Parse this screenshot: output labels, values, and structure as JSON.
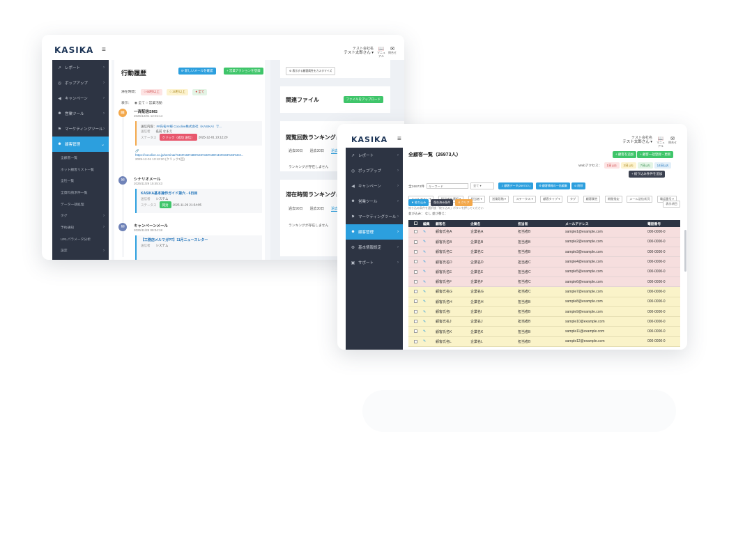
{
  "window1": {
    "logo": "KASIKA",
    "hamburger": "≡",
    "user": {
      "company": "テスト会社名",
      "name": "テスト太郎さん ▾"
    },
    "top_icons": [
      {
        "glyph": "📖",
        "label": "マニュアル"
      },
      {
        "glyph": "✉",
        "label": "問合せ"
      }
    ],
    "sidebar": [
      {
        "icon": "chart-icon",
        "glyph": "↗",
        "label": "レポート"
      },
      {
        "icon": "target-icon",
        "glyph": "◎",
        "label": "ポップアップ"
      },
      {
        "icon": "megaphone-icon",
        "glyph": "◀",
        "label": "キャンペーン"
      },
      {
        "icon": "user-plus-icon",
        "glyph": "☻",
        "label": "営業ツール"
      },
      {
        "icon": "flag-icon",
        "glyph": "⚑",
        "label": "マーケティングツール"
      },
      {
        "icon": "users-icon",
        "glyph": "☻",
        "label": "顧客管理"
      }
    ],
    "sidebar_sub": [
      "全顧客一覧",
      "ホット顧客リスト一覧",
      "全社一覧",
      "全資料請求件一覧",
      "データ一括処理",
      "タグ",
      "予約通知",
      "URLパラメータ分析",
      "設定"
    ],
    "main": {
      "title": "行動履歴",
      "btn_check": "⟳ 新しいメールを確認",
      "btn_add": "+ 営業アクションを登録",
      "filter_label": "滞在時間：",
      "filter_chips": [
        "○ 60秒以上",
        "○ 30秒以上",
        "● 全て"
      ],
      "display_label": "表示：",
      "display_opts": "◉ 全て ○ 営業活動",
      "timeline": [
        {
          "title": "一斉配信SMS",
          "date": "2025/12/01 12:01:14",
          "card_line1_prefix": "送信内容：",
          "card_line1": "##氏名##様 Cocolive株式会社（KASIKA）で...",
          "card_line2_label": "送信者",
          "card_line2": "名前 なまえ",
          "card_line3_label": "ステータス",
          "card_badge": "クリック（成功 送信）",
          "card_line3": "2025-12-01 13:12:20"
        },
        {
          "link": "https://cocolive.co.jp/seminar/%E3%82%B9%E3%83%86%E3%83%83%E3...",
          "link_date": "2025-12-01 13:12:20 (クリック1回)"
        },
        {
          "title": "シナリオメール",
          "date": "2025/11/29 15:45:43",
          "card_title": "KASIKA基本操作ガイド第六 - 6日目",
          "card_line2_label": "送信者",
          "card_line2": "システム",
          "card_line3_label": "ステータス",
          "card_badge": "開封",
          "card_line3": "2025-11-29 21:34:05"
        },
        {
          "title": "キャンペーンメール",
          "date": "2025/11/28 09:04:18",
          "card_title": "【工務店メルマガPT】11月ニュースレター",
          "card_line2_label": "送信者",
          "card_line2": "システム"
        }
      ]
    },
    "right": {
      "top_btn": "⚙ 表示する顧客属性をカスタマイズ",
      "related_title": "関連ファイル",
      "upload_btn": "ファイルをアップロード",
      "rank1_title": "閲覧回数ランキング",
      "rank1_suffix": "(ペ",
      "tabs": [
        "過去90日",
        "過去30日",
        "過去"
      ],
      "empty": "ランキングが存在しません",
      "rank2_title": "滞在時間ランキング",
      "rank2_suffix": "(ペ"
    }
  },
  "window2": {
    "logo": "KASIKA",
    "hamburger": "≡",
    "user": {
      "company": "テスト会社名",
      "name": "テスト太郎さん ▾"
    },
    "top_icons": [
      {
        "glyph": "📖",
        "label": "マニュアル"
      },
      {
        "glyph": "✉",
        "label": "問合せ"
      }
    ],
    "sidebar": [
      {
        "icon": "chart-icon",
        "glyph": "↗",
        "label": "レポート",
        "active": false
      },
      {
        "icon": "target-icon",
        "glyph": "◎",
        "label": "ポップアップ",
        "active": false
      },
      {
        "icon": "megaphone-icon",
        "glyph": "◀",
        "label": "キャンペーン",
        "active": false
      },
      {
        "icon": "user-plus-icon",
        "glyph": "☻",
        "label": "営業ツール",
        "active": false
      },
      {
        "icon": "flag-icon",
        "glyph": "⚑",
        "label": "マーケティングツール",
        "active": false
      },
      {
        "icon": "users-icon",
        "glyph": "☻",
        "label": "顧客管理",
        "active": true
      },
      {
        "icon": "gear-icon",
        "glyph": "⚙",
        "label": "基本情報設定",
        "active": false
      },
      {
        "icon": "support-icon",
        "glyph": "▣",
        "label": "サポート",
        "active": false
      }
    ],
    "main": {
      "title": "全顧客一覧（26973人）",
      "btn_add_customer": "+ 顧客を追加",
      "btn_bulk": "+ 顧客一括登録・更新",
      "web_access_label": "Webアクセス：",
      "access_chips": [
        {
          "label": "1日",
          "sub": "以内"
        },
        {
          "label": "3日",
          "sub": "以内"
        },
        {
          "label": "7日",
          "sub": "以内"
        },
        {
          "label": "14日",
          "sub": "以内"
        }
      ],
      "btn_save_filter": "+ 絞り込み条件を追加",
      "count_label": "全26973件",
      "keyword_placeholder": "キーワード",
      "select_all": "全て",
      "btn_export": "⇩ 顧客データ(26973人)",
      "btn_bulk_edit": "⚙ 顧客情報の一括編集",
      "btn_delete": "⊘ 削除",
      "filters": [
        "メールアドレ ▾",
        "担当者を選択 ▾",
        "担当者 ▾",
        "営業段階 ▾",
        "ステータス ▾",
        "顧客タイプ ▾",
        "タグ",
        "顧客属性",
        "期間指定",
        "メール送信状況",
        "電話番号 ▾"
      ],
      "btn_filter": "▼ 絞り込み",
      "btn_save": "保存済み条件",
      "btn_clear": "✕ クリア",
      "note": "絞り込み条件を選択後「絞り込み」ボタンを押してください",
      "sort_row": "並び込み： なし 並び替え：",
      "btn_display": "表示項目",
      "columns": [
        "",
        "編集",
        "顧客名",
        "企業名",
        "担当者",
        "メールアドレス",
        "電話番号"
      ],
      "rows": [
        {
          "name": "顧客氏名A",
          "company": "企業名A",
          "rep": "担当者B",
          "email": "sample1@example.com",
          "phone": "000-0000-0",
          "color": "pink"
        },
        {
          "name": "顧客氏名B",
          "company": "企業名B",
          "rep": "担当者B",
          "email": "sample2@example.com",
          "phone": "000-0000-0",
          "color": "pink"
        },
        {
          "name": "顧客氏名C",
          "company": "企業名C",
          "rep": "担当者B",
          "email": "sample3@example.com",
          "phone": "000-0000-0",
          "color": "pink"
        },
        {
          "name": "顧客氏名D",
          "company": "企業名D",
          "rep": "担当者C",
          "email": "sample4@example.com",
          "phone": "000-0000-0",
          "color": "pink"
        },
        {
          "name": "顧客氏名E",
          "company": "企業名E",
          "rep": "担当者C",
          "email": "sample5@example.com",
          "phone": "000-0000-0",
          "color": "pink"
        },
        {
          "name": "顧客氏名F",
          "company": "企業名F",
          "rep": "担当者C",
          "email": "sample6@example.com",
          "phone": "000-0000-0",
          "color": "pink"
        },
        {
          "name": "顧客氏名G",
          "company": "企業名G",
          "rep": "担当者C",
          "email": "sample7@example.com",
          "phone": "000-0000-0",
          "color": "yellow"
        },
        {
          "name": "顧客氏名H",
          "company": "企業名H",
          "rep": "担当者B",
          "email": "sample8@example.com",
          "phone": "000-0000-0",
          "color": "yellow"
        },
        {
          "name": "顧客氏名I",
          "company": "企業名I",
          "rep": "担当者B",
          "email": "sample9@example.com",
          "phone": "000-0000-0",
          "color": "yellow"
        },
        {
          "name": "顧客氏名J",
          "company": "企業名J",
          "rep": "担当者B",
          "email": "sample10@example.com",
          "phone": "000-0000-0",
          "color": "yellow"
        },
        {
          "name": "顧客氏名K",
          "company": "企業名K",
          "rep": "担当者B",
          "email": "sample11@example.com",
          "phone": "000-0000-0",
          "color": "yellow"
        },
        {
          "name": "顧客氏名L",
          "company": "企業名L",
          "rep": "担当者B",
          "email": "sample12@example.com",
          "phone": "000-0000-0",
          "color": "yellow"
        }
      ]
    }
  },
  "colors": {
    "sidebar": "#2d3443",
    "accent": "#2c9fde",
    "green": "#3fc56a",
    "row_pink": "#f6dede",
    "row_yellow": "#faf3c9"
  }
}
